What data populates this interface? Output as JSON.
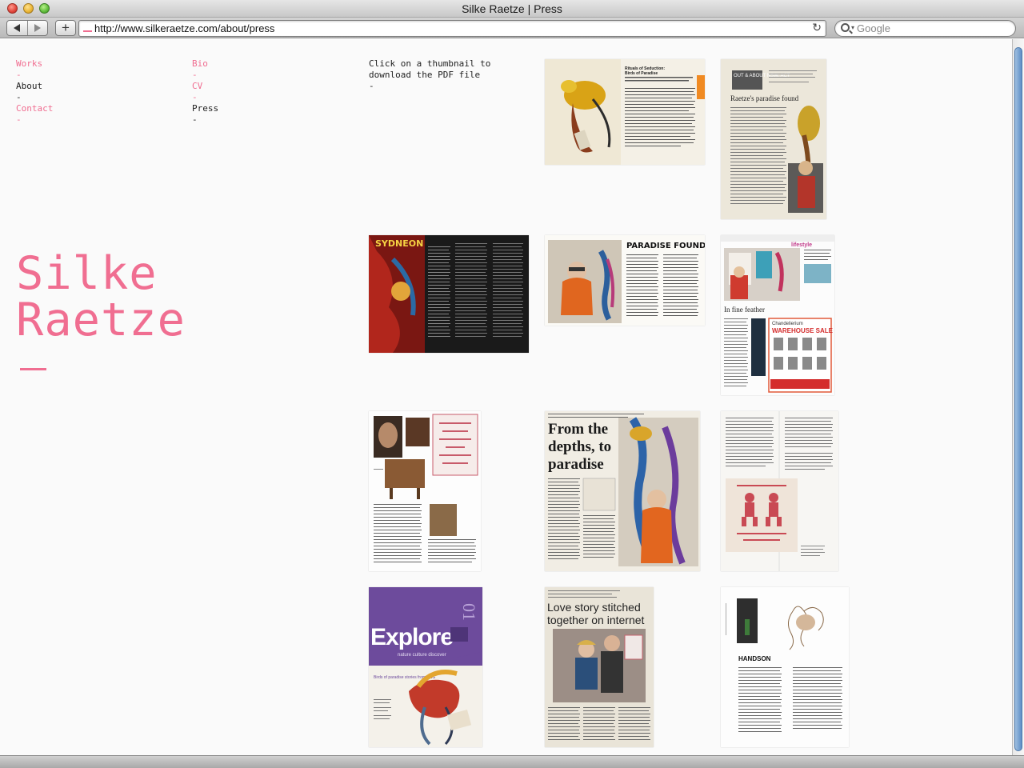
{
  "window": {
    "title": "Silke Raetze | Press"
  },
  "toolbar": {
    "url": "http://www.silkeraetze.com/about/press",
    "search_placeholder": "Google",
    "add_label": "+"
  },
  "nav": {
    "col1": [
      {
        "label": "Works"
      },
      {
        "label": "-"
      },
      {
        "label": "About"
      },
      {
        "label": "-"
      },
      {
        "label": "Contact"
      },
      {
        "label": "-"
      }
    ],
    "col2": [
      {
        "label": "Bio"
      },
      {
        "label": "-"
      },
      {
        "label": "CV"
      },
      {
        "label": "-"
      },
      {
        "label": "Press"
      },
      {
        "label": "-"
      }
    ]
  },
  "instructions": {
    "line1": "Click on a thumbnail to",
    "line2": "download the PDF file",
    "dash": "-"
  },
  "brand": {
    "line1": "Silke",
    "line2": "Raetze"
  },
  "thumbs": {
    "t1": {
      "heading": "Rituals of Seduction:",
      "sub": "Birds of Paradise"
    },
    "t2": {
      "tag": "OUT & ABOUT NSW, ACT",
      "headline": "Raetze's paradise found"
    },
    "t3": {
      "masthead": "SYDNEON"
    },
    "t4": {
      "headline": "PARADISE FOUND"
    },
    "t5": {
      "section": "lifestyle",
      "headline": "In fine feather",
      "ad": "WAREHOUSE SALE",
      "ad_brand": "Chandelierium"
    },
    "t7": {
      "headline1": "From the",
      "headline2": "depths, to",
      "headline3": "paradise"
    },
    "t9": {
      "cover_title": "Explore",
      "cover_sub": "nature culture discover",
      "cover_issue": "01",
      "cover_story": "Birds of paradise stories from PNG"
    },
    "t10": {
      "headline1": "Love story stitched",
      "headline2": "together on internet"
    },
    "t11": {
      "title": "HANDSON"
    }
  }
}
